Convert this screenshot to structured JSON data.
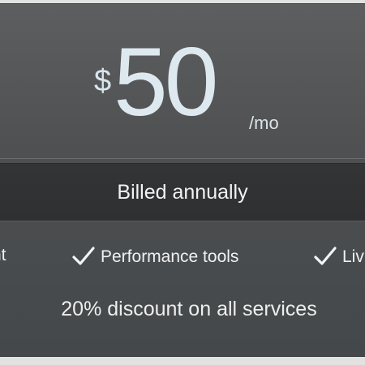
{
  "pricing": {
    "currency": "$",
    "amount": "50",
    "period": "/mo"
  },
  "billing": {
    "label": "Billed annually"
  },
  "features": [
    {
      "label": "nt",
      "icon": "checkmark-icon"
    },
    {
      "label": "Performance tools",
      "icon": "checkmark-icon"
    },
    {
      "label": "Liv",
      "icon": "checkmark-icon"
    }
  ],
  "discount": {
    "label": "20% discount on all services"
  },
  "colors": {
    "card_top": "#5d5e60",
    "card_bottom": "#44484a",
    "billing_bar": "#333436",
    "price_text": "#dde9ef",
    "body_text": "#f0f0f0",
    "page_background": "#e2e2e2"
  }
}
